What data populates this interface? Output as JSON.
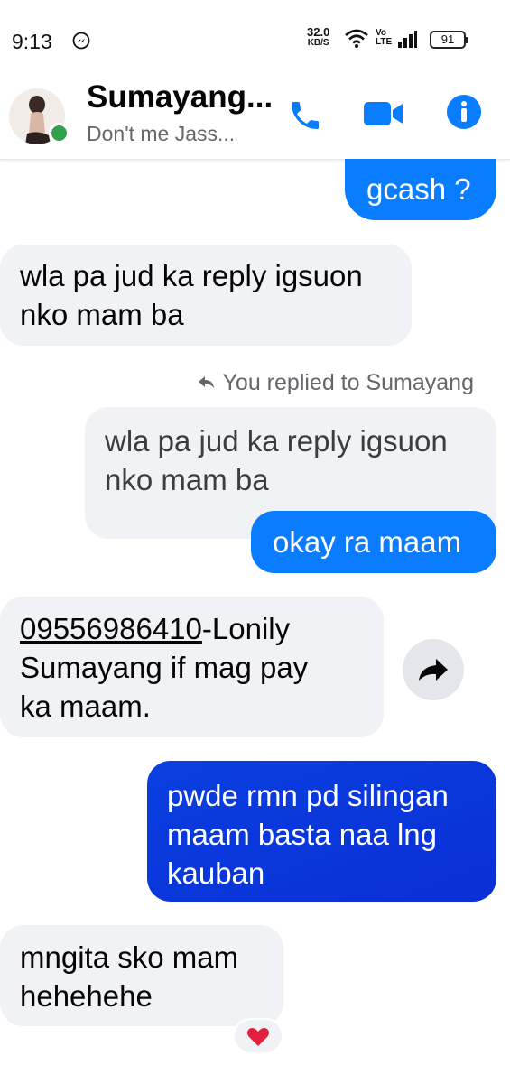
{
  "status_bar": {
    "time": "9:13",
    "net_speed": "32.0",
    "net_unit": "KB/S",
    "volte": "Vo LTE",
    "battery": "91"
  },
  "header": {
    "name": "Sumayang...",
    "status": "Don't me Jass...",
    "presence_color": "#31a24c"
  },
  "colors": {
    "outgoing": "#0a7cff",
    "outgoing_gradient_end": "#0a2fd6",
    "incoming": "#f0f2f5"
  },
  "messages": {
    "m1": "gcash ?",
    "m2_l1": "wla pa jud ka reply igsuon",
    "m2_l2": "nko mam ba",
    "reply_label": "You replied to Sumayang",
    "quote_l1": "wla pa jud ka reply igsuon",
    "quote_l2": "nko mam ba",
    "m3": "okay ra maam",
    "m4_phone": "09556986410",
    "m4_rest": "-Lonily",
    "m4_l2": "Sumayang if mag pay",
    "m4_l3": "ka maam.",
    "m5_l1": "pwde rmn pd silingan",
    "m5_l2": "maam basta naa lng",
    "m5_l3": "kauban",
    "m6_l1": "mngita sko mam",
    "m6_l2": "hehehehe",
    "reaction": "heart"
  },
  "icons": [
    "messenger-icon",
    "wifi-icon",
    "signal-icon",
    "battery-icon",
    "phone-call-icon",
    "video-call-icon",
    "info-icon",
    "reply-arrow-icon",
    "forward-icon",
    "heart-icon"
  ]
}
